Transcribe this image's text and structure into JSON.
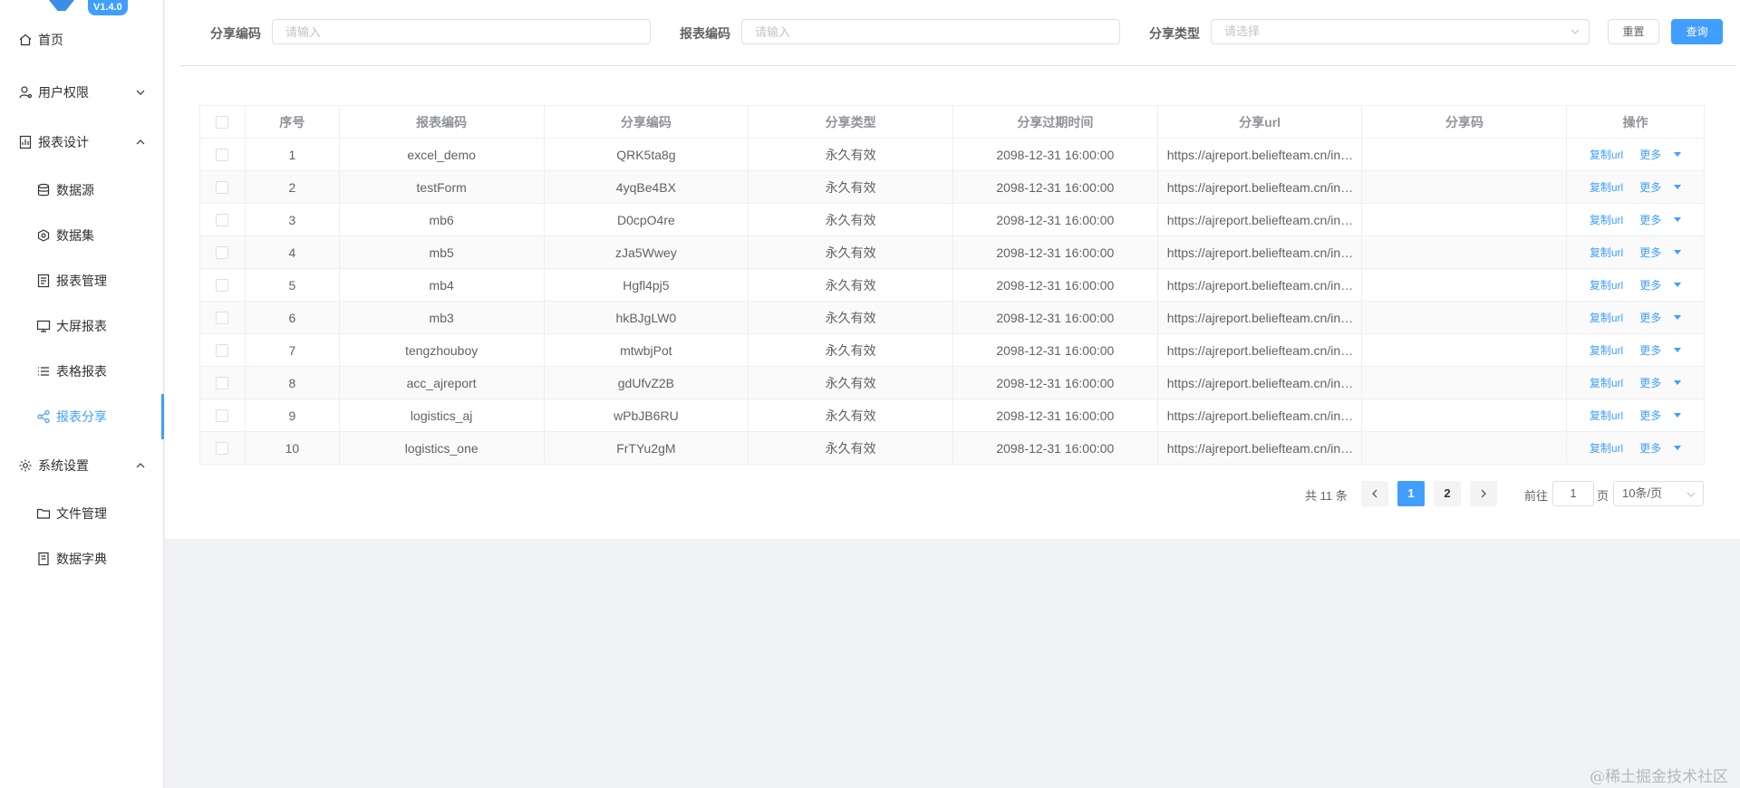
{
  "app": {
    "version": "V1.4.0"
  },
  "sidebar": {
    "items": [
      {
        "label": "首页",
        "icon": "home-icon",
        "level": "top",
        "expanded": null
      },
      {
        "label": "用户权限",
        "icon": "user-icon",
        "level": "top",
        "expanded": false
      },
      {
        "label": "报表设计",
        "icon": "report-design-icon",
        "level": "top",
        "expanded": true
      },
      {
        "label": "数据源",
        "icon": "database-icon",
        "level": "sub"
      },
      {
        "label": "数据集",
        "icon": "dataset-icon",
        "level": "sub"
      },
      {
        "label": "报表管理",
        "icon": "report-manage-icon",
        "level": "sub"
      },
      {
        "label": "大屏报表",
        "icon": "monitor-icon",
        "level": "sub"
      },
      {
        "label": "表格报表",
        "icon": "list-icon",
        "level": "sub"
      },
      {
        "label": "报表分享",
        "icon": "share-icon",
        "level": "sub",
        "active": true
      },
      {
        "label": "系统设置",
        "icon": "gear-icon",
        "level": "top",
        "expanded": true
      },
      {
        "label": "文件管理",
        "icon": "folder-icon",
        "level": "sub"
      },
      {
        "label": "数据字典",
        "icon": "book-icon",
        "level": "sub"
      }
    ]
  },
  "filters": {
    "share_code": {
      "label": "分享编码",
      "placeholder": "请输入"
    },
    "report_code": {
      "label": "报表编码",
      "placeholder": "请输入"
    },
    "share_type": {
      "label": "分享类型",
      "placeholder": "请选择"
    },
    "reset_label": "重置",
    "query_label": "查询"
  },
  "table": {
    "columns": [
      "序号",
      "报表编码",
      "分享编码",
      "分享类型",
      "分享过期时间",
      "分享url",
      "分享码",
      "操作"
    ],
    "copy_label": "复制url",
    "more_label": "更多",
    "rows": [
      {
        "no": "1",
        "report_code": "excel_demo",
        "share_code": "QRK5ta8g",
        "share_type": "永久有效",
        "expire": "2098-12-31 16:00:00",
        "url": "https://ajreport.beliefteam.cn/index.html",
        "code": ""
      },
      {
        "no": "2",
        "report_code": "testForm",
        "share_code": "4yqBe4BX",
        "share_type": "永久有效",
        "expire": "2098-12-31 16:00:00",
        "url": "https://ajreport.beliefteam.cn/index.html",
        "code": ""
      },
      {
        "no": "3",
        "report_code": "mb6",
        "share_code": "D0cpO4re",
        "share_type": "永久有效",
        "expire": "2098-12-31 16:00:00",
        "url": "https://ajreport.beliefteam.cn/index.html",
        "code": ""
      },
      {
        "no": "4",
        "report_code": "mb5",
        "share_code": "zJa5Wwey",
        "share_type": "永久有效",
        "expire": "2098-12-31 16:00:00",
        "url": "https://ajreport.beliefteam.cn/index.html",
        "code": ""
      },
      {
        "no": "5",
        "report_code": "mb4",
        "share_code": "Hgfl4pj5",
        "share_type": "永久有效",
        "expire": "2098-12-31 16:00:00",
        "url": "https://ajreport.beliefteam.cn/index.html",
        "code": ""
      },
      {
        "no": "6",
        "report_code": "mb3",
        "share_code": "hkBJgLW0",
        "share_type": "永久有效",
        "expire": "2098-12-31 16:00:00",
        "url": "https://ajreport.beliefteam.cn/index.html",
        "code": ""
      },
      {
        "no": "7",
        "report_code": "tengzhouboy",
        "share_code": "mtwbjPot",
        "share_type": "永久有效",
        "expire": "2098-12-31 16:00:00",
        "url": "https://ajreport.beliefteam.cn/index.html",
        "code": ""
      },
      {
        "no": "8",
        "report_code": "acc_ajreport",
        "share_code": "gdUfvZ2B",
        "share_type": "永久有效",
        "expire": "2098-12-31 16:00:00",
        "url": "https://ajreport.beliefteam.cn/index.html",
        "code": ""
      },
      {
        "no": "9",
        "report_code": "logistics_aj",
        "share_code": "wPbJB6RU",
        "share_type": "永久有效",
        "expire": "2098-12-31 16:00:00",
        "url": "https://ajreport.beliefteam.cn/index.html",
        "code": ""
      },
      {
        "no": "10",
        "report_code": "logistics_one",
        "share_code": "FrTYu2gM",
        "share_type": "永久有效",
        "expire": "2098-12-31 16:00:00",
        "url": "https://ajreport.beliefteam.cn/index.html",
        "code": ""
      }
    ]
  },
  "pagination": {
    "total_label": "共 11 条",
    "pages": [
      "1",
      "2"
    ],
    "current_page": "1",
    "goto_label": "前往",
    "goto_value": "1",
    "page_unit": "页",
    "page_size": "10条/页"
  },
  "watermark": "@稀土掘金技术社区",
  "colors": {
    "primary": "#409eff",
    "background": "#f0f2f5"
  }
}
